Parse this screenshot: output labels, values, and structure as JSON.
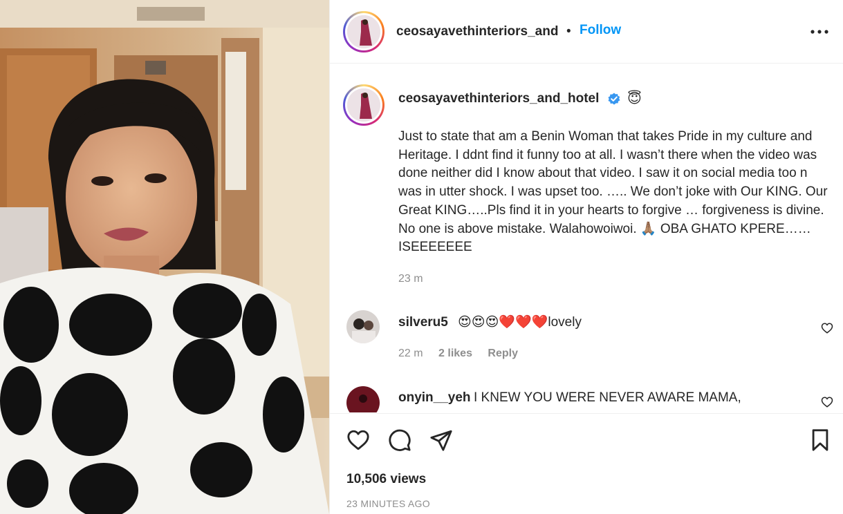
{
  "post": {
    "username": "ceosayavethinteriors_and",
    "separator": "•",
    "follow_label": "Follow"
  },
  "caption": {
    "username": "ceosayavethinteriors_and_hotel",
    "verified": true,
    "emoji": "😇",
    "text": "Just to state that am a Benin Woman that takes Pride in my culture and Heritage. I ddnt find it funny too at all. I wasn’t there when the video was done neither did I know about that video. I saw it on social media too n was in utter shock. I was upset too. ….. We don’t joke with Our KING. Our Great KING…..Pls find it in your hearts to forgive … forgiveness is divine. No one is above mistake. Walahowoiwoi. 🙏🏽 OBA GHATO KPERE……ISEEEEEEE",
    "time": "23 m"
  },
  "comments": [
    {
      "username": "silveru5",
      "text": "😍😍😍❤️❤️❤️lovely",
      "time": "22 m",
      "likes": "2 likes",
      "reply_label": "Reply"
    },
    {
      "username": "onyin__yeh",
      "text": "I KNEW YOU WERE NEVER AWARE MAMA,"
    }
  ],
  "stats": {
    "views": "10,506 views",
    "timestamp": "23 MINUTES AGO"
  },
  "colors": {
    "accent": "#0095f6",
    "text": "#262626",
    "muted": "#8e8e8e",
    "border": "#efefef",
    "verified": "#3897f0"
  },
  "icons": [
    "more-icon",
    "verified-badge-icon",
    "heart-icon",
    "comment-icon",
    "share-icon",
    "bookmark-icon"
  ]
}
